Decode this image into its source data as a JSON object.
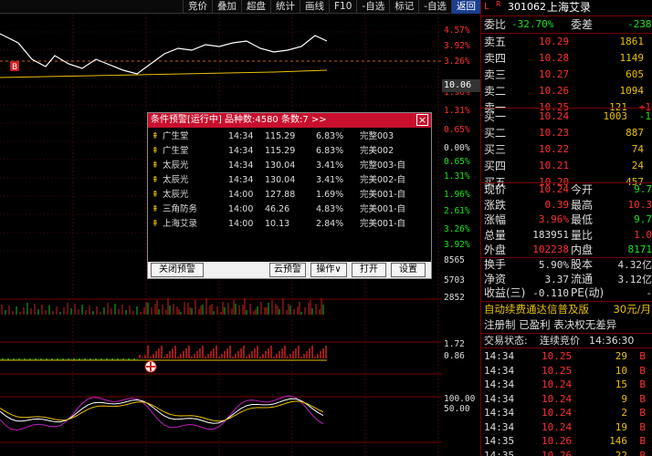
{
  "toolbar": {
    "items": [
      "竞价",
      "叠加",
      "超盘",
      "统计",
      "画线",
      "F10",
      "-自选",
      "标记",
      "-自选",
      "返回"
    ]
  },
  "axis": {
    "pct_labels": [
      {
        "t": "4.57%",
        "c": "red"
      },
      {
        "t": "3.92%",
        "c": "red"
      },
      {
        "t": "3.26%",
        "c": "red"
      },
      {
        "t": "1.96%",
        "c": "red"
      },
      {
        "t": "1.31%",
        "c": "red"
      },
      {
        "t": "0.65%",
        "c": "red"
      },
      {
        "t": "0.00%",
        "c": "white"
      },
      {
        "t": "0.65%",
        "c": "green"
      },
      {
        "t": "1.31%",
        "c": "green"
      },
      {
        "t": "1.96%",
        "c": "green"
      },
      {
        "t": "2.61%",
        "c": "green"
      },
      {
        "t": "3.26%",
        "c": "green"
      },
      {
        "t": "3.92%",
        "c": "green"
      }
    ],
    "current_price": "10.06",
    "vol_labels": [
      "8565",
      "5703",
      "2852"
    ],
    "ind1_labels": [
      "1.72",
      "0.86"
    ],
    "ind2_labels": [
      "100.00",
      "50.00"
    ],
    "b_marker": "B"
  },
  "panel": {
    "header": {
      "flag1": "L",
      "flag2": "R",
      "code": "301062",
      "name": "上海艾录"
    },
    "webi": {
      "label1": "委比",
      "value1": "-32.70%",
      "label2": "委差",
      "value2": "-238"
    },
    "asks": [
      {
        "label": "卖五",
        "price": "10.29",
        "vol": "1861"
      },
      {
        "label": "卖四",
        "price": "10.28",
        "vol": "1149"
      },
      {
        "label": "卖三",
        "price": "10.27",
        "vol": "605"
      },
      {
        "label": "卖二",
        "price": "10.26",
        "vol": "1094"
      },
      {
        "label": "卖一",
        "price": "10.25",
        "vol": "121",
        "chg": "+1"
      }
    ],
    "bids": [
      {
        "label": "买一",
        "price": "10.24",
        "vol": "1003",
        "chg": "-1"
      },
      {
        "label": "买二",
        "price": "10.23",
        "vol": "887"
      },
      {
        "label": "买三",
        "price": "10.22",
        "vol": "74"
      },
      {
        "label": "买四",
        "price": "10.21",
        "vol": "24"
      },
      {
        "label": "买五",
        "price": "10.20",
        "vol": "457"
      }
    ],
    "stats": [
      {
        "l1": "现价",
        "v1": "10.24",
        "c1": "red",
        "l2": "今开",
        "v2": "9.7",
        "c2": "green"
      },
      {
        "l1": "涨跌",
        "v1": "0.39",
        "c1": "red",
        "l2": "最高",
        "v2": "10.3",
        "c2": "red"
      },
      {
        "l1": "涨幅",
        "v1": "3.96%",
        "c1": "red",
        "l2": "最低",
        "v2": "9.7",
        "c2": "green"
      },
      {
        "l1": "总量",
        "v1": "183951",
        "c1": "white",
        "l2": "量比",
        "v2": "1.0",
        "c2": "red"
      },
      {
        "l1": "外盘",
        "v1": "102238",
        "c1": "red",
        "l2": "内盘",
        "v2": "8171",
        "c2": "green"
      }
    ],
    "stats2": [
      {
        "l1": "换手",
        "v1": "5.90%",
        "l2": "股本",
        "v2": "4.32亿"
      },
      {
        "l1": "净资",
        "v1": "3.37",
        "l2": "流通",
        "v2": "3.12亿"
      },
      {
        "l1": "收益(三)",
        "v1": "-0.110",
        "l2": "PE(动)",
        "v2": "-"
      }
    ],
    "ad": {
      "text": "自动续费通达信普及版",
      "price": "30元/月"
    },
    "tags": "注册制 已盈利 表决权无差异",
    "status": {
      "label": "交易状态:",
      "value": "连续竞价",
      "time": "14:36:30"
    },
    "ticks": [
      {
        "t": "14:34",
        "p": "10.25",
        "v": "29",
        "d": "B"
      },
      {
        "t": "14:34",
        "p": "10.25",
        "v": "10",
        "d": "B"
      },
      {
        "t": "14:34",
        "p": "10.24",
        "v": "15",
        "d": "B"
      },
      {
        "t": "14:34",
        "p": "10.24",
        "v": "9",
        "d": "B"
      },
      {
        "t": "14:34",
        "p": "10.24",
        "v": "2",
        "d": "B"
      },
      {
        "t": "14:34",
        "p": "10.24",
        "v": "19",
        "d": "B"
      },
      {
        "t": "14:35",
        "p": "10.26",
        "v": "146",
        "d": "B"
      },
      {
        "t": "14:35",
        "p": "10.26",
        "v": "22",
        "d": "B"
      }
    ]
  },
  "dialog": {
    "title": "条件预警[运行中] 品种数:4580 条数:7  >>",
    "close": "×",
    "rows": [
      {
        "name": "广生堂",
        "time": "14:34",
        "price": "115.29",
        "pct": "6.83%",
        "cond": "完整003"
      },
      {
        "name": "广生堂",
        "time": "14:34",
        "price": "115.29",
        "pct": "6.83%",
        "cond": "完美002"
      },
      {
        "name": "太辰光",
        "time": "14:34",
        "price": "130.04",
        "pct": "3.41%",
        "cond": "完整003-自"
      },
      {
        "name": "太辰光",
        "time": "14:34",
        "price": "130.04",
        "pct": "3.41%",
        "cond": "完美002-自"
      },
      {
        "name": "太辰光",
        "time": "14:00",
        "price": "127.88",
        "pct": "1.69%",
        "cond": "完美001-自"
      },
      {
        "name": "三角防务",
        "time": "14:00",
        "price": "46.26",
        "pct": "4.83%",
        "cond": "完美001-自"
      },
      {
        "name": "上海艾录",
        "time": "14:00",
        "price": "10.13",
        "pct": "2.84%",
        "cond": "完美001-自"
      }
    ],
    "buttons": {
      "close_alert": "关闭预警",
      "cloud": "云预警",
      "ops": "操作∨",
      "open": "打开",
      "settings": "设置"
    }
  },
  "colors": {
    "red": "#ff3030",
    "green": "#19e619",
    "dialog_title": "#c8102e",
    "yellow": "#e8c000"
  }
}
